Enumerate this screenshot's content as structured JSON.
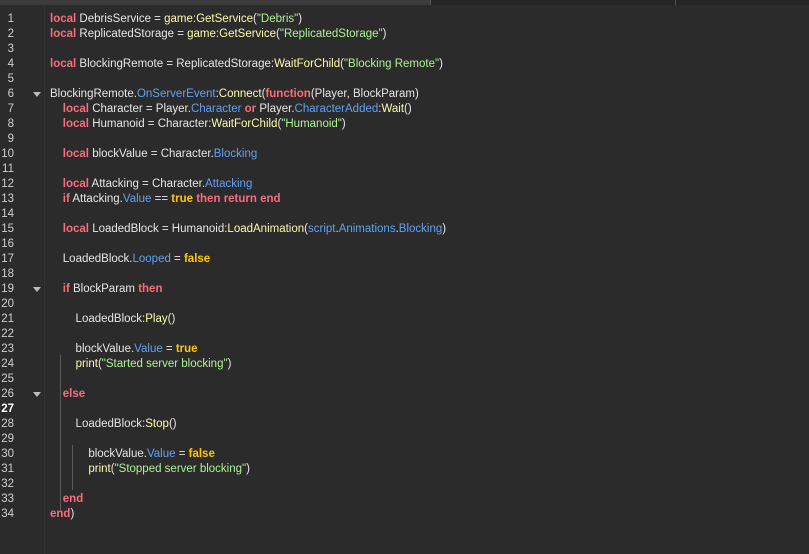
{
  "editor": {
    "lines": [
      {
        "n": "1",
        "t": [
          [
            "kw",
            "local"
          ],
          [
            "sym",
            " DebrisService = "
          ],
          [
            "fn",
            "game"
          ],
          [
            "sym",
            ":"
          ],
          [
            "fn",
            "GetService"
          ],
          [
            "sym",
            "("
          ],
          [
            "str",
            "\"Debris\""
          ],
          [
            "sym",
            ")"
          ]
        ]
      },
      {
        "n": "2",
        "t": [
          [
            "kw",
            "local"
          ],
          [
            "sym",
            " ReplicatedStorage = "
          ],
          [
            "fn",
            "game"
          ],
          [
            "sym",
            ":"
          ],
          [
            "fn",
            "GetService"
          ],
          [
            "sym",
            "("
          ],
          [
            "str",
            "\"ReplicatedStorage\""
          ],
          [
            "sym",
            ")"
          ]
        ]
      },
      {
        "n": "3",
        "t": []
      },
      {
        "n": "4",
        "t": [
          [
            "kw",
            "local"
          ],
          [
            "sym",
            " BlockingRemote = ReplicatedStorage:"
          ],
          [
            "fn",
            "WaitForChild"
          ],
          [
            "sym",
            "("
          ],
          [
            "str",
            "\"Blocking Remote\""
          ],
          [
            "sym",
            ")"
          ]
        ]
      },
      {
        "n": "5",
        "t": []
      },
      {
        "n": "6",
        "fold": true,
        "t": [
          [
            "sym",
            "BlockingRemote."
          ],
          [
            "prop",
            "OnServerEvent"
          ],
          [
            "sym",
            ":"
          ],
          [
            "fn",
            "Connect"
          ],
          [
            "sym",
            "("
          ],
          [
            "kw",
            "function"
          ],
          [
            "sym",
            "(Player, BlockParam)"
          ]
        ]
      },
      {
        "n": "7",
        "t": [
          [
            "sym",
            "    "
          ],
          [
            "kw",
            "local"
          ],
          [
            "sym",
            " Character = Player."
          ],
          [
            "prop",
            "Character"
          ],
          [
            "sym",
            " "
          ],
          [
            "kw",
            "or"
          ],
          [
            "sym",
            " Player."
          ],
          [
            "prop",
            "CharacterAdded"
          ],
          [
            "sym",
            ":"
          ],
          [
            "fn",
            "Wait"
          ],
          [
            "sym",
            "()"
          ]
        ]
      },
      {
        "n": "8",
        "t": [
          [
            "sym",
            "    "
          ],
          [
            "kw",
            "local"
          ],
          [
            "sym",
            " Humanoid = Character:"
          ],
          [
            "fn",
            "WaitForChild"
          ],
          [
            "sym",
            "("
          ],
          [
            "str",
            "\"Humanoid\""
          ],
          [
            "sym",
            ")"
          ]
        ]
      },
      {
        "n": "9",
        "t": []
      },
      {
        "n": "10",
        "t": [
          [
            "sym",
            "    "
          ],
          [
            "kw",
            "local"
          ],
          [
            "sym",
            " blockValue = Character."
          ],
          [
            "prop",
            "Blocking"
          ]
        ]
      },
      {
        "n": "11",
        "t": []
      },
      {
        "n": "12",
        "t": [
          [
            "sym",
            "    "
          ],
          [
            "kw",
            "local"
          ],
          [
            "sym",
            " Attacking = Character."
          ],
          [
            "prop",
            "Attacking"
          ]
        ]
      },
      {
        "n": "13",
        "t": [
          [
            "sym",
            "    "
          ],
          [
            "kw",
            "if"
          ],
          [
            "sym",
            " Attacking."
          ],
          [
            "prop",
            "Value"
          ],
          [
            "sym",
            " == "
          ],
          [
            "bool",
            "true"
          ],
          [
            "sym",
            " "
          ],
          [
            "kw",
            "then"
          ],
          [
            "sym",
            " "
          ],
          [
            "kw",
            "return"
          ],
          [
            "sym",
            " "
          ],
          [
            "kw",
            "end"
          ]
        ]
      },
      {
        "n": "14",
        "t": []
      },
      {
        "n": "15",
        "t": [
          [
            "sym",
            "    "
          ],
          [
            "kw",
            "local"
          ],
          [
            "sym",
            " LoadedBlock = Humanoid:"
          ],
          [
            "fn",
            "LoadAnimation"
          ],
          [
            "sym",
            "("
          ],
          [
            "prop",
            "script"
          ],
          [
            "sym",
            "."
          ],
          [
            "prop",
            "Animations"
          ],
          [
            "sym",
            "."
          ],
          [
            "prop",
            "Blocking"
          ],
          [
            "sym",
            ")"
          ]
        ]
      },
      {
        "n": "16",
        "t": []
      },
      {
        "n": "17",
        "t": [
          [
            "sym",
            "    LoadedBlock."
          ],
          [
            "prop",
            "Looped"
          ],
          [
            "sym",
            " = "
          ],
          [
            "bool",
            "false"
          ]
        ]
      },
      {
        "n": "18",
        "t": []
      },
      {
        "n": "19",
        "fold": true,
        "t": [
          [
            "sym",
            "    "
          ],
          [
            "kw",
            "if"
          ],
          [
            "sym",
            " BlockParam "
          ],
          [
            "kw",
            "then"
          ]
        ]
      },
      {
        "n": "20",
        "t": []
      },
      {
        "n": "21",
        "t": [
          [
            "sym",
            "        LoadedBlock:"
          ],
          [
            "fn",
            "Play"
          ],
          [
            "sym",
            "()"
          ]
        ]
      },
      {
        "n": "22",
        "t": []
      },
      {
        "n": "23",
        "t": [
          [
            "sym",
            "        blockValue."
          ],
          [
            "prop",
            "Value"
          ],
          [
            "sym",
            " = "
          ],
          [
            "bool",
            "true"
          ]
        ]
      },
      {
        "n": "24",
        "t": [
          [
            "sym",
            "        "
          ],
          [
            "fn",
            "print"
          ],
          [
            "sym",
            "("
          ],
          [
            "str",
            "\"Started server blocking\""
          ],
          [
            "sym",
            ")"
          ]
        ]
      },
      {
        "n": "25",
        "t": []
      },
      {
        "n": "26",
        "fold": true,
        "t": [
          [
            "sym",
            "    "
          ],
          [
            "kw",
            "else"
          ]
        ]
      },
      {
        "n": "27",
        "bright": true,
        "t": []
      },
      {
        "n": "28",
        "t": [
          [
            "sym",
            "        LoadedBlock:"
          ],
          [
            "fn",
            "Stop"
          ],
          [
            "sym",
            "()"
          ]
        ]
      },
      {
        "n": "29",
        "t": []
      },
      {
        "n": "30",
        "t": [
          [
            "sym",
            "            blockValue."
          ],
          [
            "prop",
            "Value"
          ],
          [
            "sym",
            " = "
          ],
          [
            "bool",
            "false"
          ]
        ]
      },
      {
        "n": "31",
        "t": [
          [
            "sym",
            "            "
          ],
          [
            "fn",
            "print"
          ],
          [
            "sym",
            "("
          ],
          [
            "str",
            "\"Stopped server blocking\""
          ],
          [
            "sym",
            ")"
          ]
        ]
      },
      {
        "n": "32",
        "t": []
      },
      {
        "n": "33",
        "t": [
          [
            "sym",
            "    "
          ],
          [
            "kw",
            "end"
          ]
        ]
      },
      {
        "n": "34",
        "t": [
          [
            "kw",
            "end"
          ],
          [
            "sym",
            ")"
          ]
        ]
      }
    ]
  },
  "colors": {
    "background": "#2b2b2b",
    "keyword": "#f86d7c",
    "bool": "#ffc600",
    "function": "#fdfbac",
    "property": "#61a1f1",
    "string": "#adf195",
    "text": "#e6e6e6"
  },
  "icons": {
    "fold": "chevron-down-icon"
  }
}
